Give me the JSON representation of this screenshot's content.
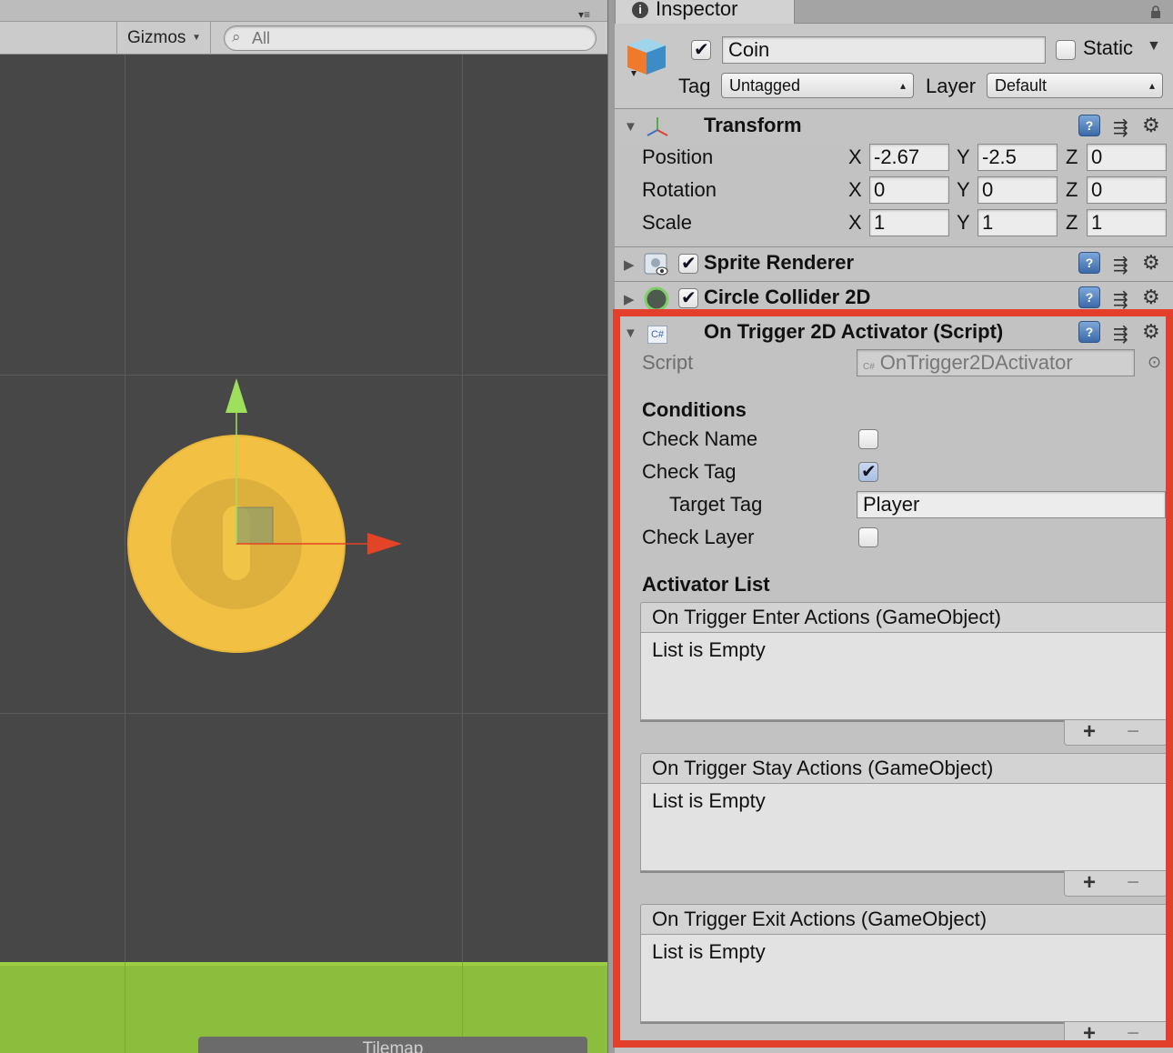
{
  "scene": {
    "gizmos_label": "Gizmos",
    "search_placeholder": "All",
    "tilemap_label": "Tilemap"
  },
  "inspector": {
    "tab_title": "Inspector",
    "object": {
      "active": true,
      "name": "Coin",
      "static_label": "Static",
      "static_checked": false,
      "tag_label": "Tag",
      "tag_value": "Untagged",
      "layer_label": "Layer",
      "layer_value": "Default"
    },
    "transform": {
      "title": "Transform",
      "rows": [
        {
          "label": "Position",
          "x": "-2.67",
          "y": "-2.5",
          "z": "0"
        },
        {
          "label": "Rotation",
          "x": "0",
          "y": "0",
          "z": "0"
        },
        {
          "label": "Scale",
          "x": "1",
          "y": "1",
          "z": "1"
        }
      ],
      "axis_labels": [
        "X",
        "Y",
        "Z"
      ]
    },
    "components": [
      {
        "title": "Sprite Renderer",
        "enabled": true,
        "icon": "sprite-renderer-icon"
      },
      {
        "title": "Circle Collider 2D",
        "enabled": true,
        "icon": "circle-collider-icon"
      }
    ],
    "script_component": {
      "title": "On Trigger 2D Activator (Script)",
      "icon": "csharp-script-icon",
      "icon_text": "C#",
      "script_label": "Script",
      "script_value": "OnTrigger2DActivator",
      "conditions_label": "Conditions",
      "check_name_label": "Check Name",
      "check_name": false,
      "check_tag_label": "Check Tag",
      "check_tag": true,
      "target_tag_label": "Target Tag",
      "target_tag_value": "Player",
      "check_layer_label": "Check Layer",
      "check_layer": false,
      "activator_list_label": "Activator List",
      "lists": [
        {
          "header": "On Trigger Enter Actions (GameObject)",
          "body": "List is Empty"
        },
        {
          "header": "On Trigger Stay Actions (GameObject)",
          "body": "List is Empty"
        },
        {
          "header": "On Trigger Exit Actions (GameObject)",
          "body": "List is Empty"
        }
      ],
      "add_symbol": "+",
      "remove_symbol": "−"
    },
    "help_symbol": "?",
    "highlight_color": "#e2402a"
  }
}
